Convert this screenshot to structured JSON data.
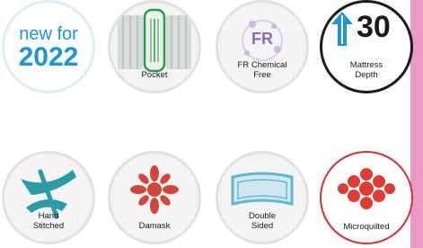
{
  "badges": {
    "new": {
      "line1": "new for",
      "line2": "2022"
    },
    "pocket": {
      "caption": "Pocket"
    },
    "fr": {
      "caption": "FR Chemical Free",
      "caption_line1": "FR Chemical",
      "caption_line2": "Free",
      "icon_text": "FR"
    },
    "depth": {
      "number": "30",
      "caption_line1": "Mattress",
      "caption_line2": "Depth"
    },
    "hand": {
      "caption_line1": "Hand",
      "caption_line2": "Stitched"
    },
    "damask": {
      "caption": "Damask"
    },
    "double": {
      "caption_line1": "Double",
      "caption_line2": "Sided"
    },
    "micro": {
      "caption": "Microquilted"
    }
  },
  "colors": {
    "brand_blue": "#1f95d6",
    "pocket_green": "#2e9a4a",
    "fr_purple": "#8b6fb3",
    "hand_teal": "#2a9ca6",
    "damask_red": "#d2453a",
    "double_blue": "#63b7d1",
    "micro_red": "#e03b34",
    "side_strip_pink": "#ec9cc4"
  },
  "icons": [
    "pocket-spring-icon",
    "fr-chemical-free-icon",
    "depth-arrow-icon",
    "hand-stitch-icon",
    "damask-pattern-icon",
    "double-sided-icon",
    "microquilt-icon"
  ]
}
